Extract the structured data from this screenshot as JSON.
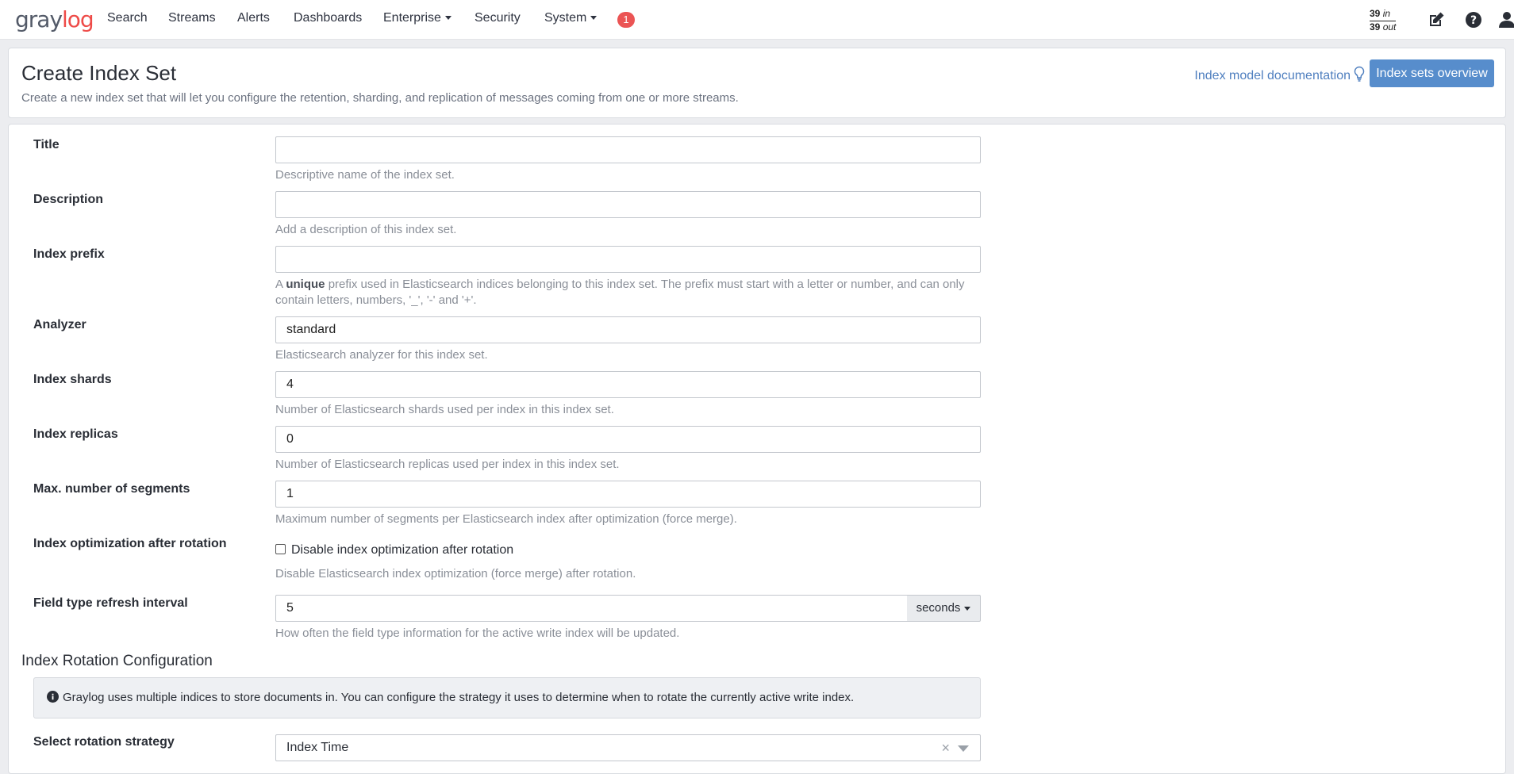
{
  "navbar": {
    "logo_main": "gray",
    "logo_accent": "log",
    "items": [
      {
        "label": "Search"
      },
      {
        "label": "Streams"
      },
      {
        "label": "Alerts"
      },
      {
        "label": "Dashboards"
      },
      {
        "label": "Enterprise",
        "dropdown": true
      },
      {
        "label": "Security"
      },
      {
        "label": "System",
        "dropdown": true
      }
    ],
    "notification_count": "1",
    "throughput": {
      "in_value": "39",
      "in_label": "in",
      "out_value": "39",
      "out_label": "out"
    },
    "icons": [
      "edit-icon",
      "help-icon",
      "user-icon"
    ]
  },
  "header": {
    "title": "Create Index Set",
    "description": "Create a new index set that will let you configure the retention, sharding, and replication of messages coming from one or more streams.",
    "doc_link": "Index model documentation",
    "overview_button": "Index sets overview"
  },
  "form": {
    "title": {
      "label": "Title",
      "value": "",
      "help": "Descriptive name of the index set."
    },
    "description": {
      "label": "Description",
      "value": "",
      "help": "Add a description of this index set."
    },
    "index_prefix": {
      "label": "Index prefix",
      "value": "",
      "help_pre": "A ",
      "help_bold": "unique",
      "help_post": " prefix used in Elasticsearch indices belonging to this index set. The prefix must start with a letter or number, and can only contain letters, numbers, '_', '-' and '+'."
    },
    "analyzer": {
      "label": "Analyzer",
      "value": "standard",
      "help": "Elasticsearch analyzer for this index set."
    },
    "index_shards": {
      "label": "Index shards",
      "value": "4",
      "help": "Number of Elasticsearch shards used per index in this index set."
    },
    "index_replicas": {
      "label": "Index replicas",
      "value": "0",
      "help": "Number of Elasticsearch replicas used per index in this index set."
    },
    "max_segments": {
      "label": "Max. number of segments",
      "value": "1",
      "help": "Maximum number of segments per Elasticsearch index after optimization (force merge)."
    },
    "index_optimization": {
      "label": "Index optimization after rotation",
      "checkbox_label": "Disable index optimization after rotation",
      "checked": false,
      "help": "Disable Elasticsearch index optimization (force merge) after rotation."
    },
    "field_type_refresh": {
      "label": "Field type refresh interval",
      "value": "5",
      "unit": "seconds",
      "help": "How often the field type information for the active write index will be updated."
    }
  },
  "rotation": {
    "section_title": "Index Rotation Configuration",
    "info": "Graylog uses multiple indices to store documents in. You can configure the strategy it uses to determine when to rotate the currently active write index.",
    "strategy_label": "Select rotation strategy",
    "strategy_value": "Index Time"
  },
  "colors": {
    "accent_blue": "#578dcc",
    "link_blue": "#4f7fbf",
    "badge_red": "#eb5454",
    "logo_red": "#ee4b48"
  }
}
